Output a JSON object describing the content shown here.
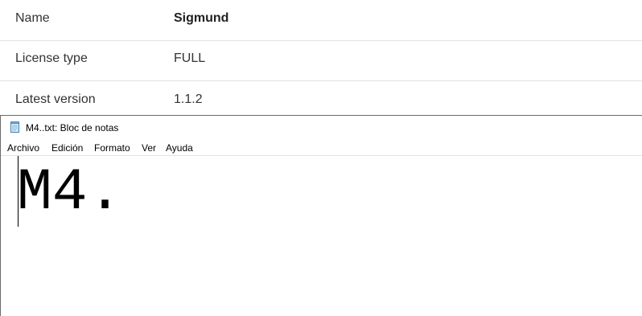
{
  "info_table": {
    "rows": [
      {
        "label": "Name",
        "value": "Sigmund"
      },
      {
        "label": "License type",
        "value": "FULL"
      },
      {
        "label": "Latest version",
        "value": "1.1.2"
      }
    ]
  },
  "notepad": {
    "title": "M4..txt: Bloc de notas",
    "icon": "notepad-document-icon",
    "menu": [
      "Archivo",
      "Edición",
      "Formato",
      "Ver",
      "Ayuda"
    ],
    "content": "M4."
  }
}
